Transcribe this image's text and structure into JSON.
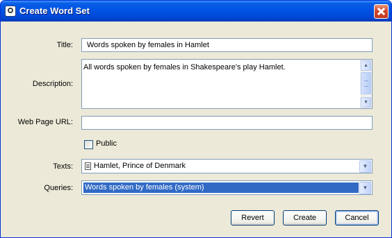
{
  "window": {
    "title": "Create Word Set"
  },
  "form": {
    "title_label": "Title:",
    "title_value": "Words spoken by females in Hamlet",
    "description_label": "Description:",
    "description_value": "All words spoken by females in Shakespeare's play Hamlet.",
    "url_label": "Web Page URL:",
    "url_value": "",
    "public_label": "Public",
    "public_checked": false,
    "texts_label": "Texts:",
    "texts_value": "Hamlet, Prince of Denmark",
    "queries_label": "Queries:",
    "queries_value": "Words spoken by females (system)"
  },
  "buttons": {
    "revert": "Revert",
    "create": "Create",
    "cancel": "Cancel"
  },
  "icons": {
    "app": "app-logo-icon",
    "close": "close-icon",
    "document": "document-icon",
    "dropdown": "chevron-down-icon"
  },
  "colors": {
    "titlebar": "#0055e5",
    "selection": "#316ac5",
    "dialog_bg": "#ece9d8",
    "field_border": "#7f9db9"
  }
}
